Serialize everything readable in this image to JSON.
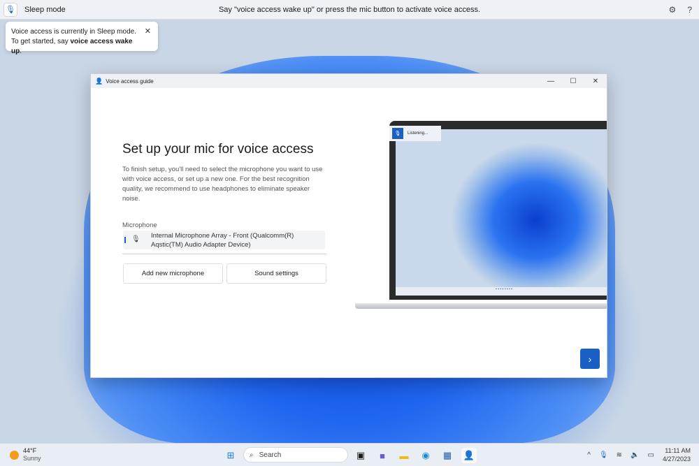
{
  "topbar": {
    "mode": "Sleep mode",
    "hint": "Say \"voice access wake up\" or press the mic button to activate voice access.",
    "settings_icon": "⚙",
    "help": "?"
  },
  "tooltip": {
    "text1": "Voice access is currently in Sleep mode. To get started, say ",
    "bold": "voice access wake up",
    "end": "."
  },
  "window": {
    "title": "Voice access guide",
    "heading": "Set up your mic for voice access",
    "description": "To finish setup, you'll need to select the microphone you want to use with voice access, or set up a new one. For the best recognition quality, we recommend to use headphones to eliminate speaker noise.",
    "mic_label": "Microphone",
    "mic_value": "Internal Microphone Array - Front (Qualcomm(R) Aqstic(TM) Audio Adapter Device)",
    "add_button": "Add new microphone",
    "sound_button": "Sound settings",
    "listening": "Listening..."
  },
  "taskbar": {
    "temp": "44°F",
    "condition": "Sunny",
    "search": "Search",
    "time": "11:11 AM",
    "date": "4/27/2023"
  },
  "colors": {
    "accent": "#1a5fc4"
  }
}
